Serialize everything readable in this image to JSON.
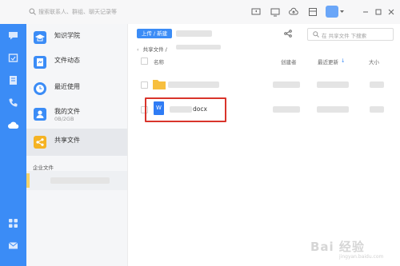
{
  "topbar": {
    "search_placeholder": "搜索联系人、群组、聊天记录等",
    "icons": [
      "screen-share-icon",
      "monitor-icon",
      "cloud-upload-icon",
      "panel-icon",
      "app-avatar-icon",
      "minimize-icon",
      "maximize-icon",
      "close-icon"
    ]
  },
  "rail": {
    "icons": [
      "chat-icon",
      "calendar-icon",
      "document-icon",
      "phone-icon",
      "cloud-icon",
      "apps-grid-icon",
      "mail-icon"
    ],
    "accent": "#3b8cf6"
  },
  "nav": {
    "items": [
      {
        "label": "知识学院",
        "icon": "graduation-cap-icon"
      },
      {
        "label": "文件动态",
        "icon": "file-activity-icon"
      },
      {
        "label": "最近使用",
        "icon": "clock-icon"
      },
      {
        "label": "我的文件",
        "sub": "0B/2GB",
        "icon": "user-icon"
      },
      {
        "label": "共享文件",
        "icon": "share-icon",
        "active": true
      }
    ],
    "corp_label": "企业文件"
  },
  "main": {
    "upload_label": "上传 / 新建",
    "search_placeholder": "在 共享文件 下搜索",
    "breadcrumb": "共享文件  /",
    "columns": {
      "name": "名称",
      "creator": "创建者",
      "updated": "最近更新",
      "size": "大小"
    },
    "files": [
      {
        "type": "folder",
        "name": ""
      },
      {
        "type": "word",
        "name": "docx",
        "icon_letter": "W",
        "highlighted": true
      }
    ]
  },
  "watermark": {
    "text": "Bai 经验",
    "sub": "jingyan.baidu.com"
  }
}
